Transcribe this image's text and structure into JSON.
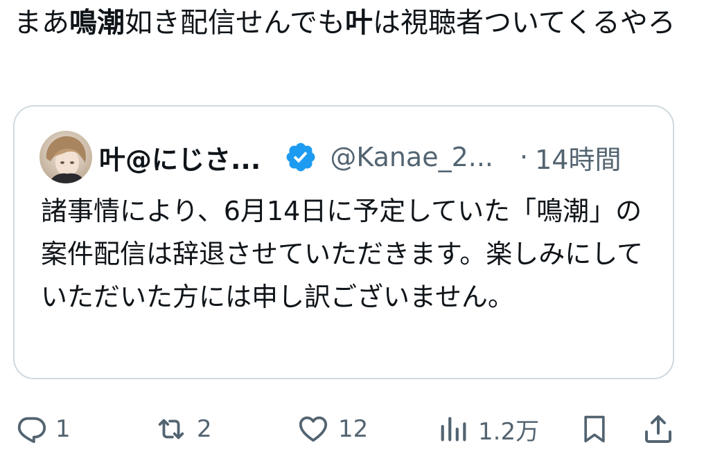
{
  "tweet": {
    "text_parts": [
      "まあ",
      "鳴潮",
      "如き配信せんでも",
      "叶",
      "は視聴者ついてくるやろ"
    ]
  },
  "quote": {
    "author_name": "叶@にじさ...",
    "handle": "@Kanae_2...",
    "separator": "·",
    "time_ago": "14時間",
    "text": "諸事情により、6月14日に予定していた「鳴潮」の案件配信は辞退させていただきます。楽しみにしていただいた方には申し訳ございません。",
    "verified_color": "#1d9bf0"
  },
  "actions": {
    "reply_count": "1",
    "retweet_count": "2",
    "like_count": "12",
    "views_count": "1.2万"
  },
  "icons": {
    "reply": "reply-icon",
    "retweet": "retweet-icon",
    "like": "heart-icon",
    "views": "views-icon",
    "bookmark": "bookmark-icon",
    "share": "share-icon"
  }
}
